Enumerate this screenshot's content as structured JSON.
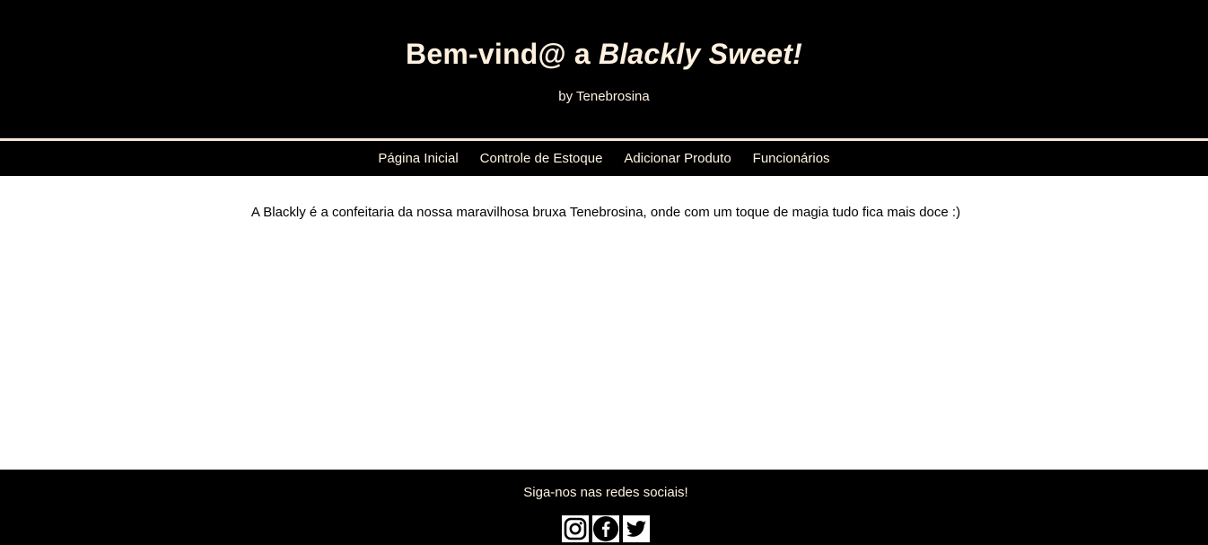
{
  "header": {
    "title_prefix": "Bem-vind@ a ",
    "title_brand": "Blackly Sweet!",
    "subtitle": "by Tenebrosina"
  },
  "nav": {
    "items": [
      {
        "label": "Página Inicial"
      },
      {
        "label": "Controle de Estoque"
      },
      {
        "label": "Adicionar Produto"
      },
      {
        "label": "Funcionários"
      }
    ]
  },
  "main": {
    "intro": "A Blackly é a confeitaria da nossa maravilhosa bruxa Tenebrosina, onde com um toque de magia tudo fica mais doce :)"
  },
  "footer": {
    "text": "Siga-nos nas redes sociais!",
    "social": [
      {
        "icon": "instagram-icon"
      },
      {
        "icon": "facebook-icon"
      },
      {
        "icon": "twitter-icon"
      }
    ]
  },
  "colors": {
    "background_dark": "#000000",
    "text_cream": "#fff1e0",
    "divider": "#f3e6d6",
    "content_bg": "#ffffff"
  }
}
